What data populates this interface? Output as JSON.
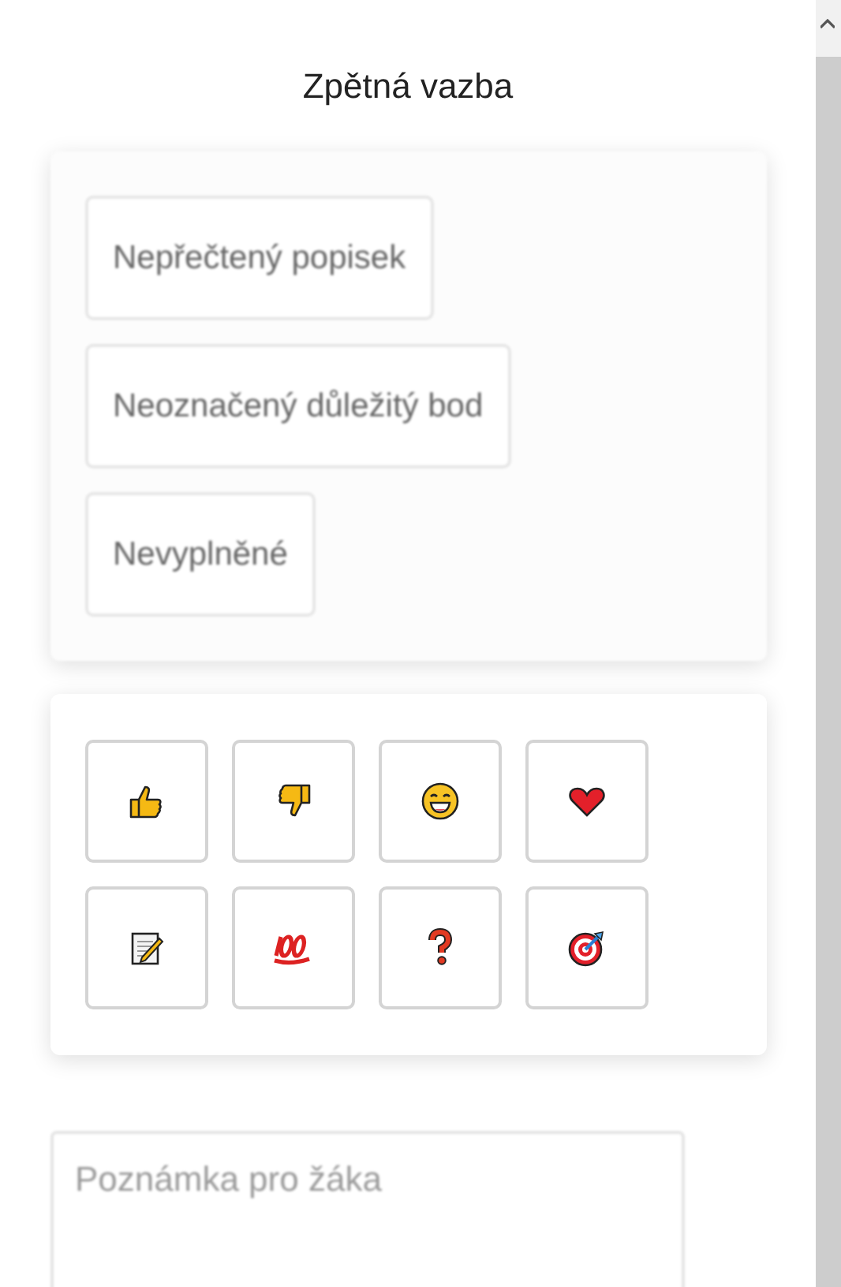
{
  "panel": {
    "title": "Zpětná vazba"
  },
  "issues": {
    "blurred": true,
    "items": [
      {
        "label": "Nepřečtený popisek"
      },
      {
        "label": "Neoznačený důležitý bod"
      },
      {
        "label": "Nevyplněné"
      }
    ]
  },
  "reactions": [
    {
      "kind": "thumbs-up"
    },
    {
      "kind": "thumbs-down"
    },
    {
      "kind": "grin"
    },
    {
      "kind": "heart"
    },
    {
      "kind": "memo"
    },
    {
      "kind": "hundred"
    },
    {
      "kind": "question"
    },
    {
      "kind": "target"
    }
  ],
  "note": {
    "placeholder": "Poznámka pro žáka",
    "blurred": true
  }
}
